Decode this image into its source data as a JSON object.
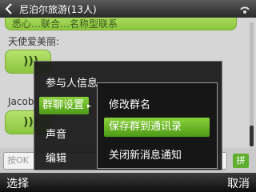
{
  "window": {
    "title": "尼泊尔旅游(13人)"
  },
  "chat": {
    "top_partial_text": "悉心…联合…名称型联系",
    "messages": [
      {
        "sender": "天使爱美丽:"
      },
      {
        "sender": "Jacob"
      }
    ]
  },
  "input": {
    "placeholder": "按OK"
  },
  "ime_label": "拼",
  "softkeys": {
    "left": "选择",
    "right": "取消"
  },
  "menu": {
    "items": [
      {
        "label": "参与人信息"
      },
      {
        "label": "群聊设置"
      },
      {
        "label": "声音"
      },
      {
        "label": "编辑"
      }
    ],
    "selected": 1
  },
  "submenu": {
    "items": [
      {
        "label": "修改群名"
      },
      {
        "label": "保存群到通讯录"
      },
      {
        "label": "关闭新消息通知"
      }
    ],
    "selected": 1
  },
  "colors": {
    "accent": "#79b92f",
    "titlebar": "#3a3a3a"
  }
}
